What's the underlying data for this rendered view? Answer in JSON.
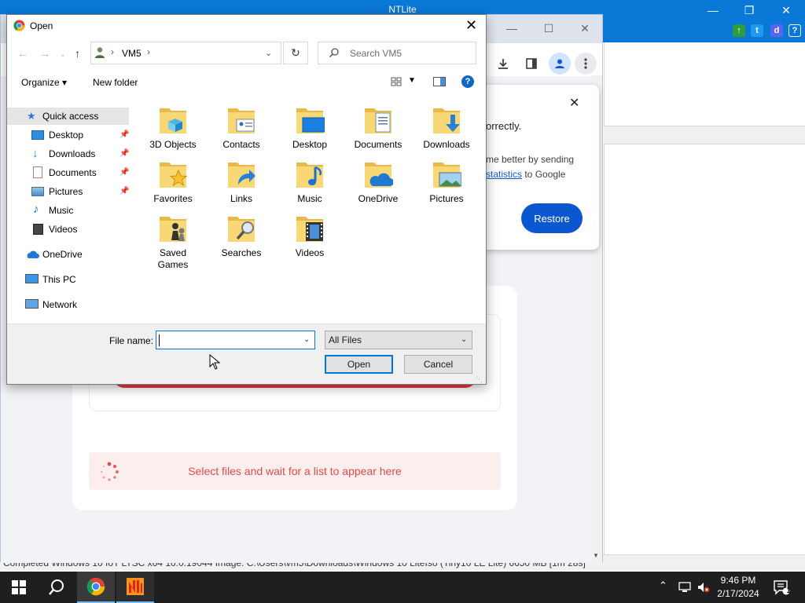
{
  "ntlite": {
    "title": "NTLite",
    "status_text": "Completed   Windows 10 IoT LTSC x64   10.0.19044   Image: C:\\Users\\vm5\\Downloads\\Windows 10 LiteIso (Tiny10 LE Lite) 6650 MB [1m 28s]"
  },
  "chrome": {
    "restore_popup": {
      "text_line1": "orrectly.",
      "text_line2": "me better by sending",
      "link": "statistics",
      "text_line3": " to Google",
      "restore_label": "Restore"
    },
    "upload_message": "Select files and wait for a list to appear here"
  },
  "dialog": {
    "title": "Open",
    "address_path": "VM5",
    "search_placeholder": "Search VM5",
    "organize_label": "Organize ▾",
    "new_folder_label": "New folder",
    "sidebar": [
      {
        "label": "Quick access",
        "icon": "star-icon",
        "pinned": false
      },
      {
        "label": "Desktop",
        "icon": "desktop-icon",
        "pinned": true
      },
      {
        "label": "Downloads",
        "icon": "download-icon",
        "pinned": true
      },
      {
        "label": "Documents",
        "icon": "document-icon",
        "pinned": true
      },
      {
        "label": "Pictures",
        "icon": "picture-icon",
        "pinned": true
      },
      {
        "label": "Music",
        "icon": "music-icon",
        "pinned": false
      },
      {
        "label": "Videos",
        "icon": "video-icon",
        "pinned": false
      },
      {
        "label": "OneDrive",
        "icon": "cloud-icon",
        "pinned": false
      },
      {
        "label": "This PC",
        "icon": "computer-icon",
        "pinned": false
      },
      {
        "label": "Network",
        "icon": "network-icon",
        "pinned": false
      }
    ],
    "folders": [
      {
        "label": "3D Objects",
        "icon": "cube-icon"
      },
      {
        "label": "Contacts",
        "icon": "contact-card-icon"
      },
      {
        "label": "Desktop",
        "icon": "desktop-icon"
      },
      {
        "label": "Documents",
        "icon": "document-icon"
      },
      {
        "label": "Downloads",
        "icon": "download-arrow-icon"
      },
      {
        "label": "Favorites",
        "icon": "star-icon"
      },
      {
        "label": "Links",
        "icon": "link-arrow-icon"
      },
      {
        "label": "Music",
        "icon": "music-note-icon"
      },
      {
        "label": "OneDrive",
        "icon": "cloud-icon"
      },
      {
        "label": "Pictures",
        "icon": "picture-icon"
      },
      {
        "label": "Saved\nGames",
        "icon": "chess-icon"
      },
      {
        "label": "Searches",
        "icon": "magnifier-icon"
      },
      {
        "label": "Videos",
        "icon": "film-icon"
      }
    ],
    "file_name_label": "File name:",
    "file_name_value": "",
    "file_type_value": "All Files",
    "open_label": "Open",
    "cancel_label": "Cancel"
  },
  "taskbar": {
    "time": "9:46 PM",
    "date": "2/17/2024",
    "notification_count": "1"
  },
  "colors": {
    "accent": "#0078d7",
    "ntlite_blue": "#0a78d7",
    "chrome_button": "#0b57d0",
    "folder_yellow": "#f8d775",
    "error_red": "#e14a4a"
  }
}
